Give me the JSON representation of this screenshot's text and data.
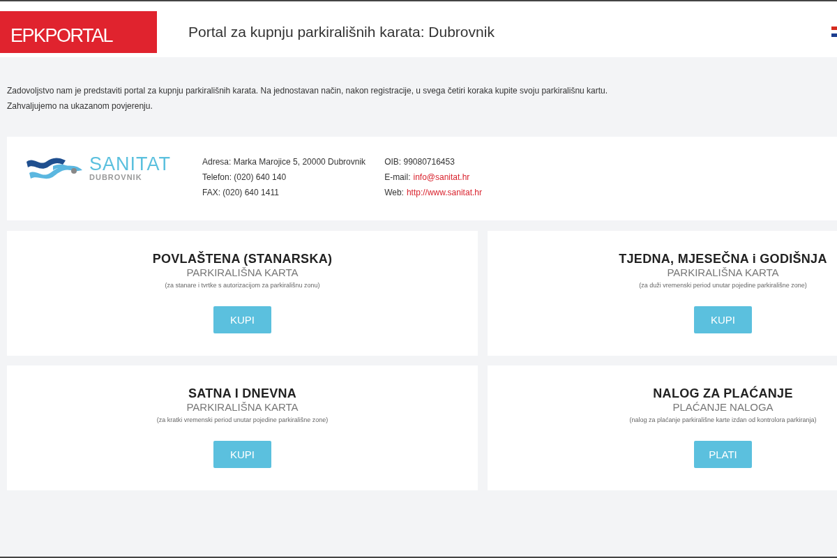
{
  "header": {
    "logo": "EPKPORTAL",
    "title": "Portal za kupnju parkirališnih karata: Dubrovnik"
  },
  "intro": [
    "Zadovoljstvo nam je predstaviti portal za kupnju parkirališnih karata. Na jednostavan način, nakon registracije, u svega četiri koraka kupite svoju parkirališnu kartu.",
    "Zahvaljujemo na ukazanom povjerenju."
  ],
  "company": {
    "name": "SANITAT",
    "city": "DUBROVNIK",
    "columns": [
      [
        {
          "text": "Adresa: Marka Marojice 5, 20000 Dubrovnik"
        },
        {
          "text": "Telefon: (020) 640 140"
        },
        {
          "text": "FAX: (020) 640 1411"
        }
      ],
      [
        {
          "text": "OIB: 99080716453"
        },
        {
          "text": "E-mail:",
          "link": "info@sanitat.hr"
        },
        {
          "text": "Web:",
          "link": "http://www.sanitat.hr"
        }
      ]
    ]
  },
  "cards": [
    {
      "title": "POVLAŠTENA (STANARSKA)",
      "subtitle": "PARKIRALIŠNA KARTA",
      "note": "(za stanare i tvrtke s autorizacijom za parkirališnu zonu)",
      "button": "KUPI"
    },
    {
      "title": "TJEDNA, MJESEČNA i GODIŠNJA",
      "subtitle": "PARKIRALIŠNA KARTA",
      "note": "(za duži vremenski period unutar pojedine parkirališne zone)",
      "button": "KUPI"
    },
    {
      "title": "SATNA I DNEVNA",
      "subtitle": "PARKIRALIŠNA KARTA",
      "note": "(za kratki vremenski period unutar pojedine parkirališne zone)",
      "button": "KUPI"
    },
    {
      "title": "NALOG ZA PLAĆANJE",
      "subtitle": "PLAĆANJE NALOGA",
      "note": "(nalog za plaćanje parkirališne karte izdan od kontrolora parkiranja)",
      "button": "PLATI"
    }
  ]
}
